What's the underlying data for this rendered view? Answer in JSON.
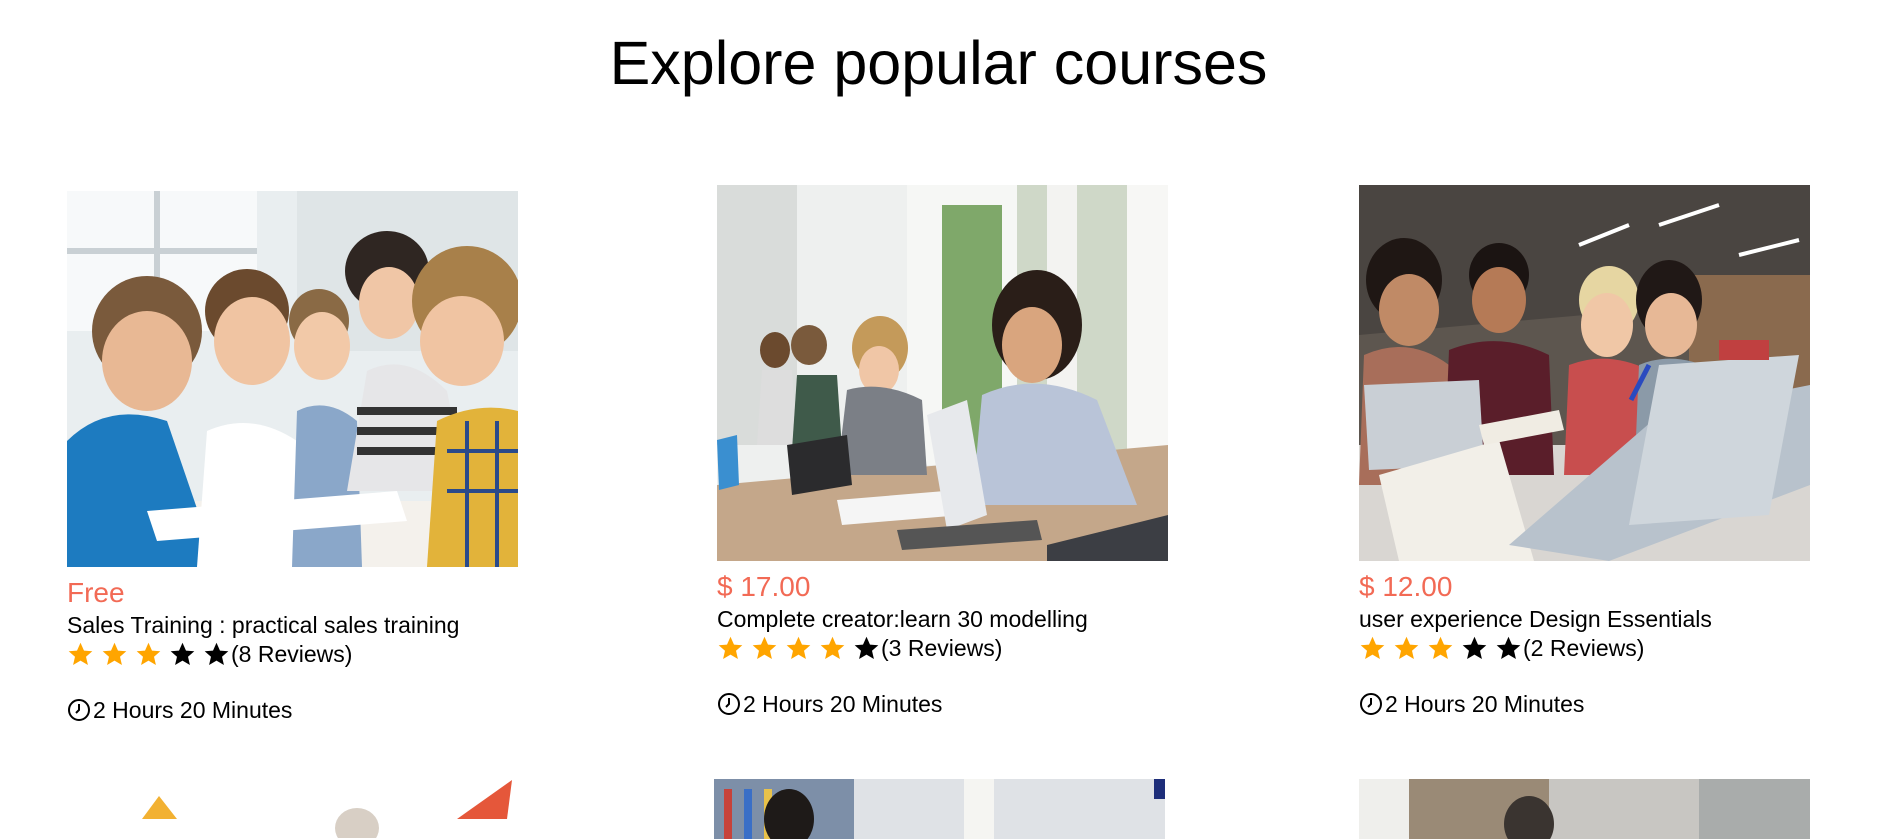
{
  "page": {
    "title": "Explore popular courses"
  },
  "colors": {
    "price": "#f26a55",
    "star_filled": "#ffa500",
    "star_empty": "#000000"
  },
  "courses": [
    {
      "price": "Free",
      "title": "Sales Training : practical sales training",
      "rating": 3,
      "max_rating": 5,
      "reviews": "(8 Reviews)",
      "duration": "2 Hours 20 Minutes",
      "image_icon": "classroom-kids-photo"
    },
    {
      "price": "$ 17.00",
      "title": "Complete creator:learn 30 modelling",
      "rating": 4,
      "max_rating": 5,
      "reviews": "(3 Reviews)",
      "duration": "2 Hours 20 Minutes",
      "image_icon": "students-laptops-photo"
    },
    {
      "price": "$ 12.00",
      "title": "user experience Design Essentials",
      "rating": 3,
      "max_rating": 5,
      "reviews": "(2 Reviews)",
      "duration": "2 Hours 20 Minutes",
      "image_icon": "group-study-photo"
    }
  ]
}
